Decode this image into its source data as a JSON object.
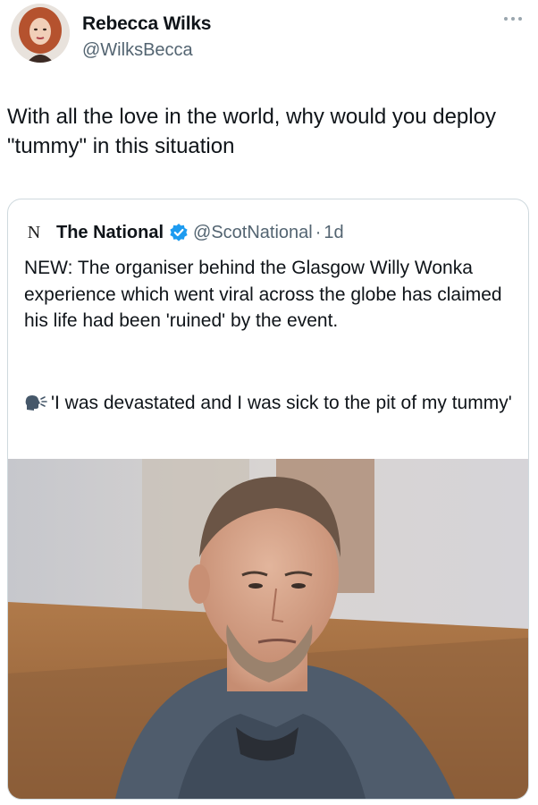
{
  "tweet": {
    "author_name": "Rebecca Wilks",
    "author_handle": "@WilksBecca",
    "text": "With all the love in the world, why would you deploy \"tummy\" in this situation",
    "more_icon": "more-horizontal-icon"
  },
  "quoted": {
    "logo_text": "N",
    "name": "The National",
    "handle": "@ScotNational",
    "separator": "·",
    "time": "1d",
    "verified_icon": "verified-badge-icon",
    "body": "NEW: The organiser behind the Glasgow Willy Wonka experience which went viral across the globe has claimed his life had been 'ruined' by the event.",
    "speaking_icon": "speaking-head-icon",
    "quote": "'I was devastated and I was sick to the pit of my tummy'",
    "media_icon": "photo-icon"
  },
  "colors": {
    "text": "#0f1419",
    "secondary_text": "#536471",
    "border": "#cfd9de",
    "verified": "#1d9bf0"
  }
}
